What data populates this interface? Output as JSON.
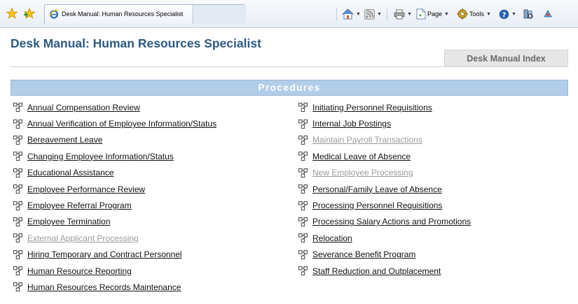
{
  "browser": {
    "tab_title": "Desk Manual: Human Resources Specialist",
    "toolbar": {
      "page_label": "Page",
      "tools_label": "Tools"
    }
  },
  "page": {
    "title": "Desk Manual: Human Resources Specialist",
    "index_tab": "Desk Manual Index",
    "procedures_header": "Procedures"
  },
  "procedures": {
    "left": [
      {
        "label": "Annual Compensation Review",
        "enabled": true
      },
      {
        "label": "Annual Verification of Employee Information/Status",
        "enabled": true
      },
      {
        "label": "Bereavement Leave",
        "enabled": true
      },
      {
        "label": "Changing Employee Information/Status",
        "enabled": true
      },
      {
        "label": "Educational Assistance",
        "enabled": true
      },
      {
        "label": "Employee Performance Review",
        "enabled": true
      },
      {
        "label": "Employee Referral Program",
        "enabled": true
      },
      {
        "label": "Employee Termination",
        "enabled": true
      },
      {
        "label": "External Applicant Processing",
        "enabled": false
      },
      {
        "label": "Hiring Temporary and Contract Personnel",
        "enabled": true
      },
      {
        "label": "Human Resource Reporting",
        "enabled": true
      },
      {
        "label": "Human Resources Records Maintenance",
        "enabled": true
      }
    ],
    "right": [
      {
        "label": "Initiating Personnel Requisitions",
        "enabled": true
      },
      {
        "label": "Internal Job Postings",
        "enabled": true
      },
      {
        "label": "Maintain Payroll Transactions",
        "enabled": false
      },
      {
        "label": "Medical Leave of Absence",
        "enabled": true
      },
      {
        "label": "New Employee Processing",
        "enabled": false
      },
      {
        "label": "Personal/Family Leave of Absence",
        "enabled": true
      },
      {
        "label": "Processing Personnel Requisitions",
        "enabled": true
      },
      {
        "label": "Processing Salary Actions and Promotions",
        "enabled": true
      },
      {
        "label": "Relocation",
        "enabled": true
      },
      {
        "label": "Severance Benefit Program",
        "enabled": true
      },
      {
        "label": "Staff Reduction and Outplacement",
        "enabled": true
      }
    ]
  },
  "colors": {
    "title": "#2d5a83",
    "header_bg": "#b2cde8",
    "link": "#111111",
    "link_disabled": "#9a9a9a"
  },
  "icons": {
    "favorites": "star-icon",
    "add_favorites": "add-favorites-icon",
    "home": "home-icon",
    "feeds": "rss-icon",
    "print": "print-icon",
    "page": "page-icon",
    "tools": "gear-icon",
    "help": "help-icon",
    "research": "research-icon",
    "procedure": "procedure-link-icon"
  }
}
